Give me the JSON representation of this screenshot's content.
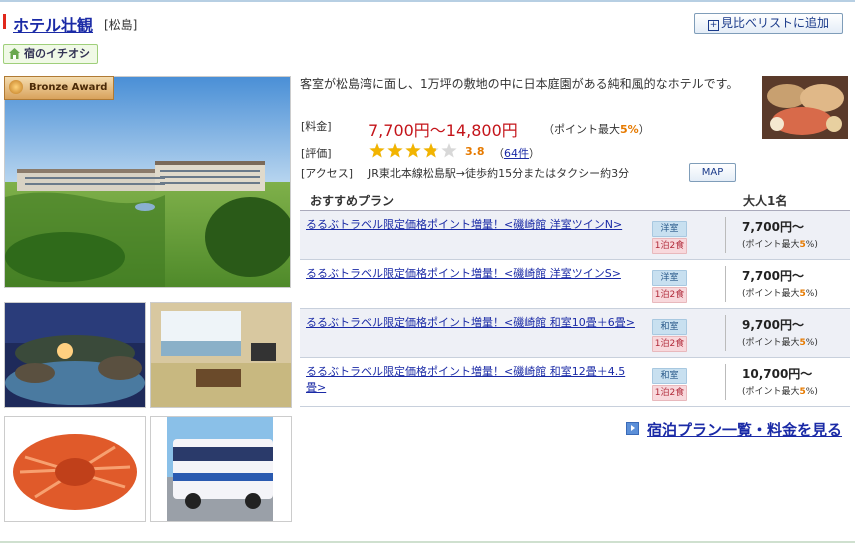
{
  "hotel": {
    "name": "ホテル壮観",
    "area": "[松島]",
    "compare_label": "見比べリストに追加",
    "ichioshi": "宿のイチオシ",
    "award": "Bronze Award",
    "description": "客室が松島湾に面し、1万坪の敷地の中に日本庭園がある純和風的なホテルです。"
  },
  "price": {
    "label": "[料金]",
    "value": "7,700円〜14,800円",
    "point_prefix": "（ポイント最大",
    "point_value": "5%",
    "point_suffix": "）"
  },
  "rating": {
    "label": "[評価]",
    "value": 3.8,
    "value_text": "3.8",
    "review_open": "（",
    "review_count": "64件",
    "review_close": "）"
  },
  "access": {
    "label": "[アクセス]",
    "text": "JR東北本線松島駅→徒歩約15分またはタクシー約3分",
    "map_label": "MAP"
  },
  "plans": {
    "header_plan": "おすすめプラン",
    "header_price": "大人1名",
    "items": [
      {
        "name": "るるぶトラベル限定価格ポイント増量！<磯崎館 洋室ツインN>",
        "room": "洋室",
        "meal": "1泊2食",
        "price": "7,700円〜",
        "point_prefix": "(ポイント最大",
        "point_value": "5",
        "point_suffix": "%)"
      },
      {
        "name": "るるぶトラベル限定価格ポイント増量！<磯崎館 洋室ツインS>",
        "room": "洋室",
        "meal": "1泊2食",
        "price": "7,700円〜",
        "point_prefix": "(ポイント最大",
        "point_value": "5",
        "point_suffix": "%)"
      },
      {
        "name": "るるぶトラベル限定価格ポイント増量！<磯崎館 和室10畳＋6畳>",
        "room": "和室",
        "meal": "1泊2食",
        "price": "9,700円〜",
        "point_prefix": "(ポイント最大",
        "point_value": "5",
        "point_suffix": "%)"
      },
      {
        "name": "るるぶトラベル限定価格ポイント増量！<磯崎館 和室12畳＋4.5畳>",
        "room": "和室",
        "meal": "1泊2食",
        "price": "10,700円〜",
        "point_prefix": "(ポイント最大",
        "point_value": "5",
        "point_suffix": "%)"
      }
    ]
  },
  "more_link": "宿泊プラン一覧・料金を見る",
  "colors": {
    "link": "#1a2aa6",
    "price": "#c4141a",
    "point": "#e67a00",
    "star": "#f2b400"
  }
}
